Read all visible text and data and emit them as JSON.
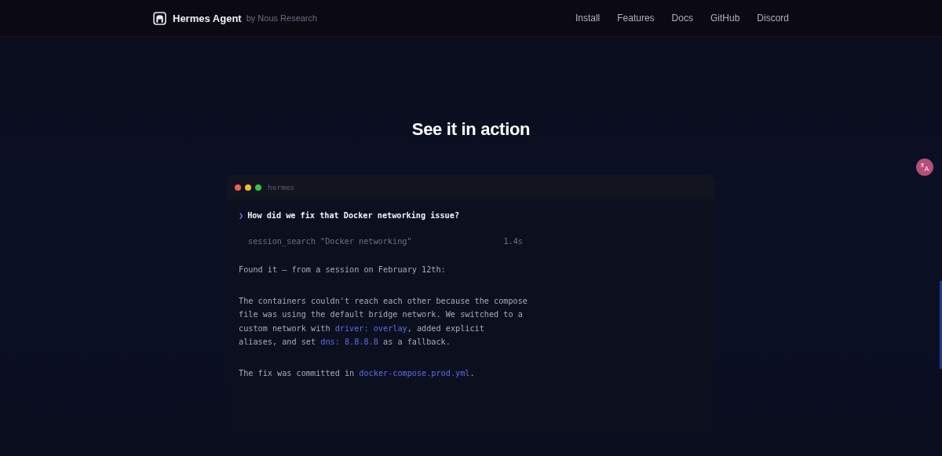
{
  "nav": {
    "brand": "Hermes Agent",
    "byline": "by Nous Research",
    "links": [
      "Install",
      "Features",
      "Docs",
      "GitHub",
      "Discord"
    ]
  },
  "section": {
    "title": "See it in action"
  },
  "terminal": {
    "title": "hermes",
    "prompt_mark": "❯",
    "prompt": "How did we fix that Docker networking issue?",
    "tool": {
      "call": "session_search \"Docker networking\"",
      "time": "1.4s"
    },
    "paragraphs": [
      [
        [
          {
            "text": "Found it — from a session on February 12th:",
            "code": false
          }
        ]
      ],
      [
        [
          {
            "text": "The containers couldn't reach each other because the compose",
            "code": false
          }
        ],
        [
          {
            "text": "file was using the default bridge network. We switched to a",
            "code": false
          }
        ],
        [
          {
            "text": "custom network with ",
            "code": false
          },
          {
            "text": "driver: overlay",
            "code": true
          },
          {
            "text": ", added explicit",
            "code": false
          }
        ],
        [
          {
            "text": "aliases, and set ",
            "code": false
          },
          {
            "text": "dns: 8.8.8.8",
            "code": true
          },
          {
            "text": " as a fallback.",
            "code": false
          }
        ]
      ],
      [
        [
          {
            "text": "The fix was committed in ",
            "code": false
          },
          {
            "text": "docker-compose.prod.yml",
            "code": true
          },
          {
            "text": ".",
            "code": false
          }
        ]
      ]
    ]
  }
}
